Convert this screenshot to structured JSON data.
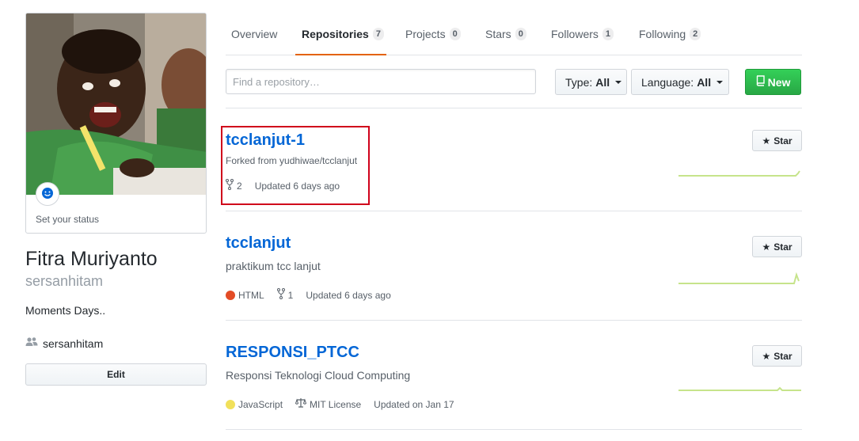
{
  "profile": {
    "status_text": "Set your status",
    "name": "Fitra Muriyanto",
    "login": "sersanhitam",
    "bio": "Moments Days..",
    "org": "sersanhitam",
    "edit_label": "Edit",
    "icons": {
      "status": "smiley-icon",
      "org": "people-icon"
    }
  },
  "tabs": [
    {
      "label": "Overview",
      "count": null,
      "active": false
    },
    {
      "label": "Repositories",
      "count": "7",
      "active": true
    },
    {
      "label": "Projects",
      "count": "0",
      "active": false
    },
    {
      "label": "Stars",
      "count": "0",
      "active": false
    },
    {
      "label": "Followers",
      "count": "1",
      "active": false
    },
    {
      "label": "Following",
      "count": "2",
      "active": false
    }
  ],
  "filters": {
    "search_placeholder": "Find a repository…",
    "type_label": "Type:",
    "type_value": "All",
    "language_label": "Language:",
    "language_value": "All",
    "new_label": "New"
  },
  "repos": [
    {
      "name": "tcclanjut-1",
      "description": "",
      "forked_from": "Forked from yudhiwae/tcclanjut",
      "language": null,
      "language_color": null,
      "forks": "2",
      "license": null,
      "updated": "Updated 6 days ago",
      "star_label": "Star",
      "highlighted": true
    },
    {
      "name": "tcclanjut",
      "description": "praktikum tcc lanjut",
      "forked_from": "",
      "language": "HTML",
      "language_color": "#e34c26",
      "forks": "1",
      "license": null,
      "updated": "Updated 6 days ago",
      "star_label": "Star",
      "highlighted": false
    },
    {
      "name": "RESPONSI_PTCC",
      "description": "Responsi Teknologi Cloud Computing",
      "forked_from": "",
      "language": "JavaScript",
      "language_color": "#f1e05a",
      "forks": null,
      "license": "MIT License",
      "updated": "Updated on Jan 17",
      "star_label": "Star",
      "highlighted": false
    }
  ],
  "colors": {
    "link": "#0366d6",
    "tab_accent": "#e36209",
    "new_button": "#28a745",
    "spark": "#c6e48b",
    "highlight": "#d0021b"
  }
}
